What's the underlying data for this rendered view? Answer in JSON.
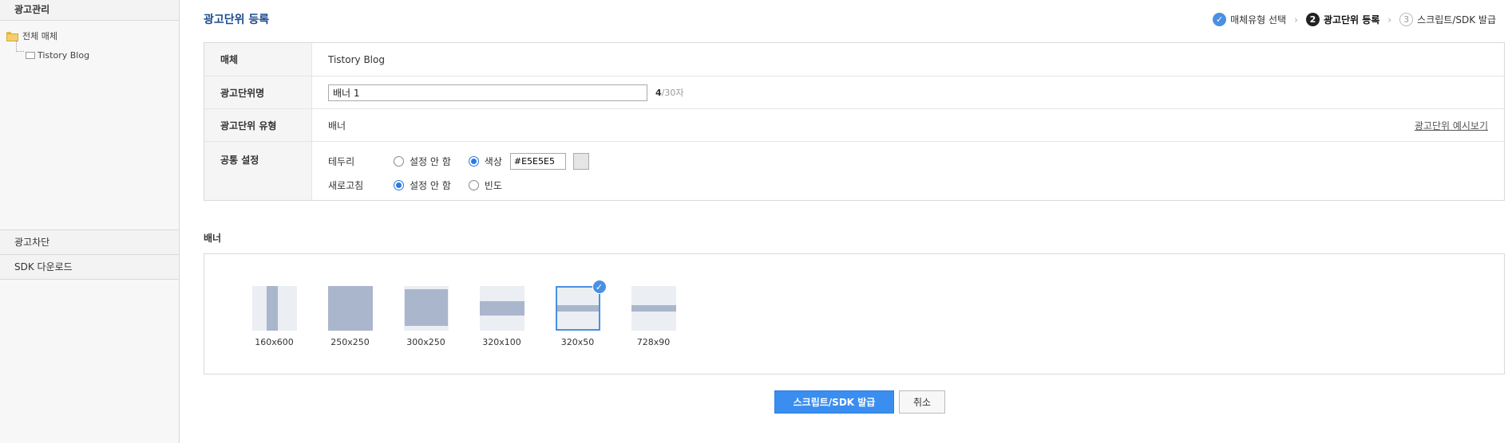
{
  "sidebar": {
    "header": "광고관리",
    "tree": {
      "root_label": "전체 매체",
      "child_label": "Tistory Blog"
    },
    "menu": [
      "광고차단",
      "SDK 다운로드"
    ]
  },
  "page": {
    "title": "광고단위 등록"
  },
  "steps": [
    {
      "number": "✓",
      "label": "매체유형 선택",
      "state": "done"
    },
    {
      "number": "2",
      "label": "광고단위 등록",
      "state": "active"
    },
    {
      "number": "3",
      "label": "스크립트/SDK 발급",
      "state": "todo"
    }
  ],
  "form": {
    "media": {
      "label": "매체",
      "value": "Tistory Blog"
    },
    "ad_unit_name": {
      "label": "광고단위명",
      "value": "배너 1",
      "count": "4",
      "limit": "/30자"
    },
    "ad_unit_type": {
      "label": "광고단위 유형",
      "value": "배너",
      "preview_link": "광고단위 예시보기"
    },
    "common": {
      "label": "공통 설정",
      "border": {
        "label": "테두리",
        "option_none": "설정 안 함",
        "option_color": "색상",
        "selected": "color",
        "color_value": "#E5E5E5",
        "swatch_color": "#E5E5E5"
      },
      "refresh": {
        "label": "새로고침",
        "option_none": "설정 안 함",
        "option_freq": "빈도",
        "selected": "none"
      }
    }
  },
  "banner_section": {
    "title": "배너",
    "selected_size": "320x50",
    "sizes": [
      "160x600",
      "250x250",
      "300x250",
      "320x100",
      "320x50",
      "728x90"
    ]
  },
  "buttons": {
    "submit": "스크립트/SDK 발급",
    "cancel": "취소"
  },
  "colors": {
    "title": "#1A4C8C",
    "accent": "#3A8EF0",
    "thumb_fill": "#AAB6CC",
    "thumb_bg": "#EBEEF3"
  }
}
